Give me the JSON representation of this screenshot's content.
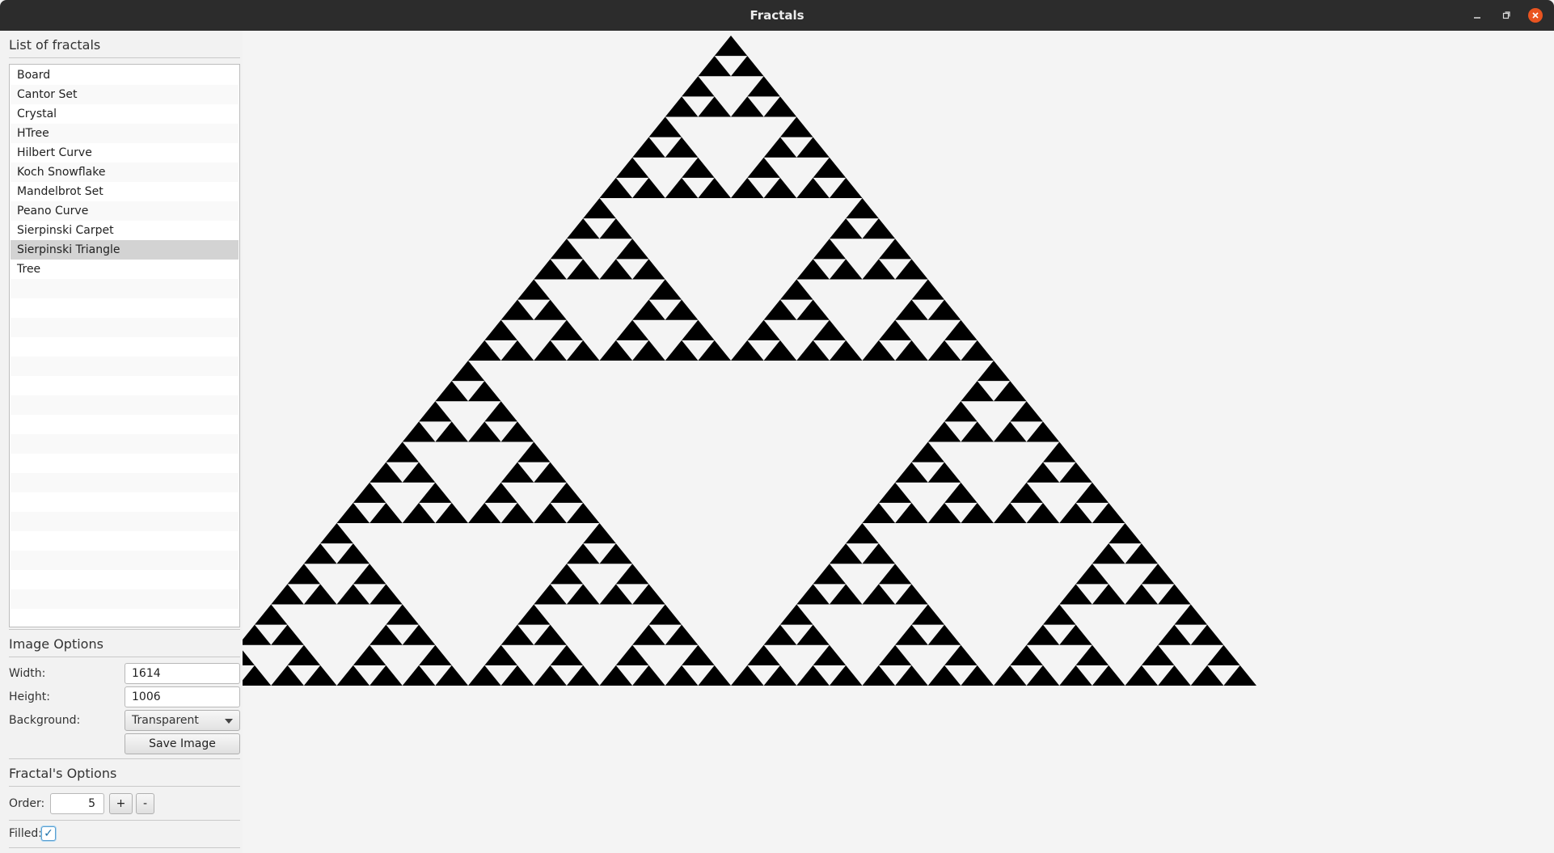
{
  "window": {
    "title": "Fractals",
    "minimize_icon": "minimize-icon",
    "maximize_icon": "restore-icon",
    "close_icon": "close-icon"
  },
  "sidebar": {
    "list_title": "List of fractals",
    "items": [
      {
        "label": "Board"
      },
      {
        "label": "Cantor Set"
      },
      {
        "label": "Crystal"
      },
      {
        "label": "HTree"
      },
      {
        "label": "Hilbert Curve"
      },
      {
        "label": "Koch Snowflake"
      },
      {
        "label": "Mandelbrot Set"
      },
      {
        "label": "Peano Curve"
      },
      {
        "label": "Sierpinski Carpet"
      },
      {
        "label": "Sierpinski Triangle"
      },
      {
        "label": "Tree"
      }
    ],
    "selected_item": "Sierpinski Triangle"
  },
  "image_options": {
    "title": "Image Options",
    "width_label": "Width:",
    "width_value": "1614",
    "height_label": "Height:",
    "height_value": "1006",
    "background_label": "Background:",
    "background_value": "Transparent",
    "save_label": "Save Image"
  },
  "fractal_options": {
    "title": "Fractal's Options",
    "order_label": "Order:",
    "order_value": "5",
    "increment_label": "+",
    "decrement_label": "-",
    "filled_label": "Filled:",
    "filled": true,
    "check_glyph": "✓"
  },
  "fractal": {
    "name": "Sierpinski Triangle",
    "order": 5,
    "fill_color": "#000000",
    "background_color": "#f4f4f4"
  }
}
